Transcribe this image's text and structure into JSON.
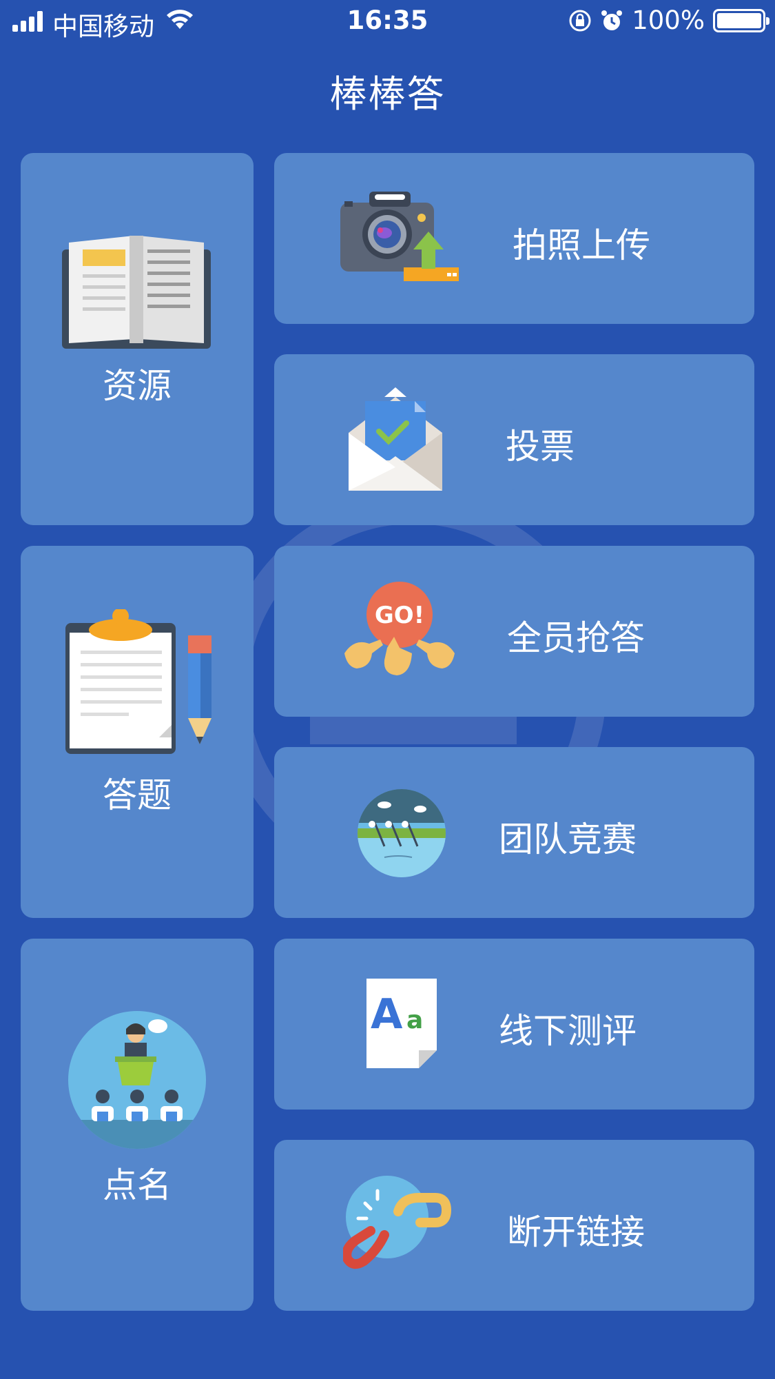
{
  "status_bar": {
    "carrier": "中国移动",
    "time": "16:35",
    "battery": "100%"
  },
  "header": {
    "title": "棒棒答"
  },
  "left_tiles": [
    {
      "label": "资源",
      "icon": "book-icon"
    },
    {
      "label": "答题",
      "icon": "clipboard-pencil-icon"
    },
    {
      "label": "点名",
      "icon": "classroom-roll-call-icon"
    }
  ],
  "right_tiles": [
    {
      "label": "拍照上传",
      "icon": "camera-upload-icon"
    },
    {
      "label": "投票",
      "icon": "vote-envelope-icon"
    },
    {
      "label": "全员抢答",
      "icon": "go-buzzer-icon"
    },
    {
      "label": "团队竞赛",
      "icon": "rowing-team-icon"
    },
    {
      "label": "线下测评",
      "icon": "document-aa-icon"
    },
    {
      "label": "断开链接",
      "icon": "broken-link-icon"
    }
  ],
  "colors": {
    "background": "#2652b0",
    "tile": "#5587cc"
  }
}
